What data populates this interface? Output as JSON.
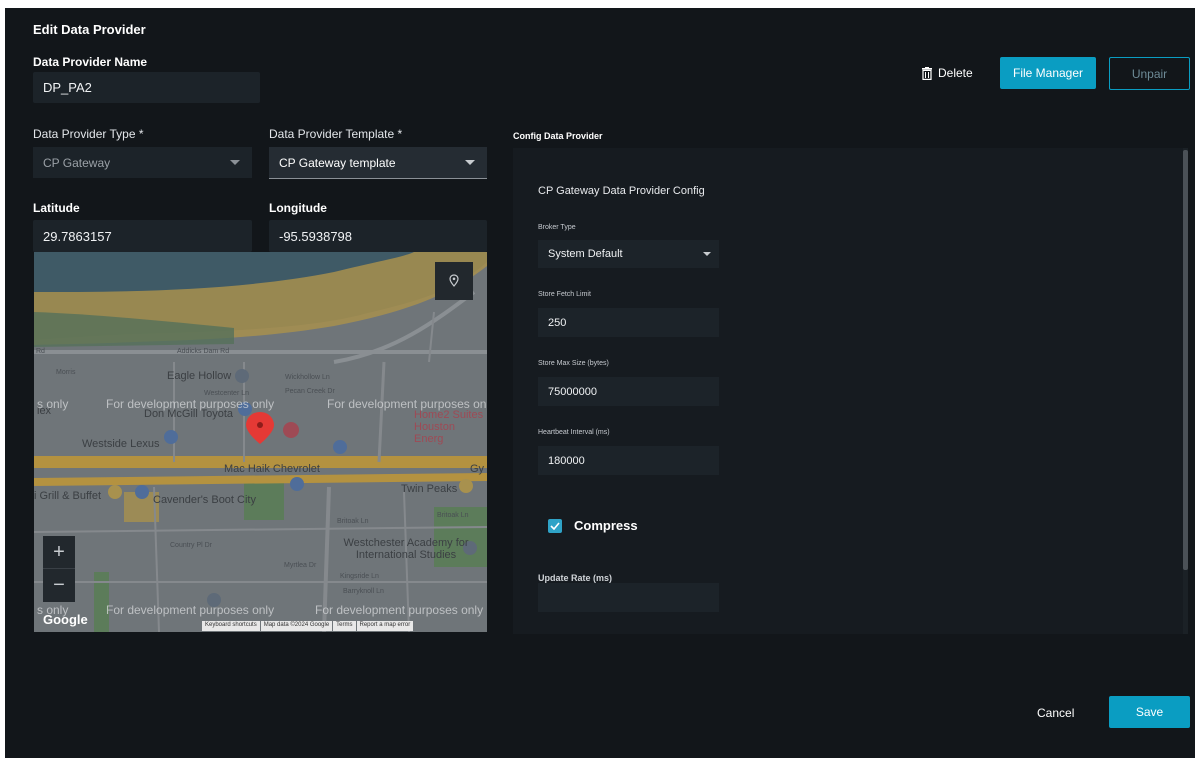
{
  "page": {
    "title": "Edit Data Provider"
  },
  "name_field": {
    "label": "Data Provider Name",
    "value": "DP_PA2"
  },
  "header_actions": {
    "delete": "Delete",
    "file_manager": "File Manager",
    "unpair": "Unpair"
  },
  "type_field": {
    "label": "Data Provider Type *",
    "value": "CP Gateway"
  },
  "template_field": {
    "label": "Data Provider Template *",
    "value": "CP Gateway template"
  },
  "latitude": {
    "label": "Latitude",
    "value": "29.7863157"
  },
  "longitude": {
    "label": "Longitude",
    "value": "-95.5938798"
  },
  "map": {
    "watermark": "For development purposes only",
    "watermark_partial_left": "s only",
    "places": {
      "eagle_hollow": "Eagle Hollow",
      "don_mcgill": "Don McGill Toyota",
      "westside_lexus": "Westside Lexus",
      "mac_haik": "Mac Haik Chevrolet",
      "cavenders": "Cavender's Boot City",
      "twin_peaks": "Twin Peaks",
      "westchester": "Westchester Academy for International Studies",
      "home2": "Home2 Suites Houston Energ",
      "grill": "i Grill & Buffet",
      "gy": "Gy"
    },
    "roads": {
      "addicks": "Addicks Dam Rd",
      "rd": "Rd",
      "morris": "Morris",
      "wickhollow": "Wickhollow Ln",
      "pecan": "Pecan Creek Dr",
      "westcenter": "Westcenter Ln",
      "britoak": "Britoak Ln",
      "britoak2": "Britoak Ln",
      "kingsride": "Kingsride Ln",
      "barryknoll": "Barryknoll Ln",
      "myrtlea": "Myrtlea Dr",
      "country": "Country Pl Dr",
      "lex": "lex"
    },
    "zoom_in": "+",
    "zoom_out": "−",
    "logo": "Google",
    "footer": {
      "shortcuts": "Keyboard shortcuts",
      "map_data": "Map data ©2024 Google",
      "terms": "Terms",
      "report": "Report a map error"
    },
    "colors": {
      "water": "#3f5a66",
      "land": "#6f7579",
      "grass": "#5c7c5a",
      "sand": "#a8914e",
      "highway": "#b49240",
      "marker": "#e53935"
    }
  },
  "config": {
    "section_title": "Config Data Provider",
    "title": "CP Gateway Data Provider Config",
    "broker_type": {
      "label": "Broker Type",
      "value": "System Default"
    },
    "fetch_limit": {
      "label": "Store Fetch Limit",
      "value": "250"
    },
    "max_size": {
      "label": "Store Max Size (bytes)",
      "value": "75000000"
    },
    "heartbeat": {
      "label": "Heartbeat Interval (ms)",
      "value": "180000"
    },
    "compress": {
      "label": "Compress",
      "checked": true
    },
    "update_rate": {
      "label": "Update Rate (ms)",
      "value": ""
    }
  },
  "footer": {
    "cancel": "Cancel",
    "save": "Save"
  },
  "colors": {
    "background": "#12161a",
    "accent": "#0a9dc2",
    "input": "#1c2329"
  }
}
